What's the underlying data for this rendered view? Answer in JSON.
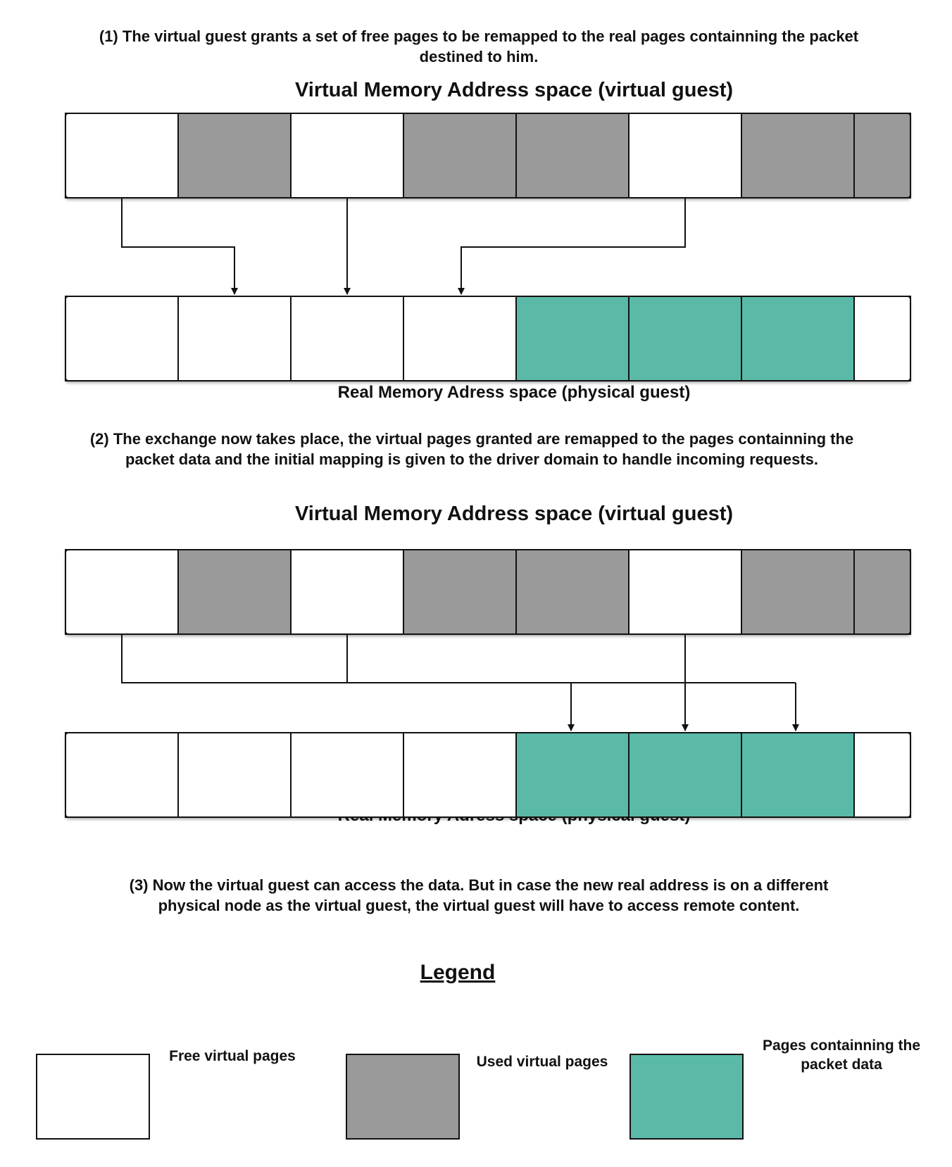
{
  "step1": {
    "line1": "(1)  The virtual guest grants a set of free pages to be remapped to the real pages containning the packet",
    "line2": "destined to him."
  },
  "step2": {
    "line1": "(2)  The exchange now takes place, the virtual pages granted are remapped to the pages containning the",
    "line2": "packet data and the initial mapping is given to the driver domain to handle incoming requests."
  },
  "step3": {
    "line1": "(3) Now the virtual guest can access the data. But in case the new real  address is on a different",
    "line2": "physical node as the virtual guest, the virtual guest will have to access remote content."
  },
  "diagram1": {
    "virtual_title": "Virtual Memory Address space (virtual guest)",
    "real_title": "Real Memory Adress space (physical guest)",
    "virtual_pages": [
      "free",
      "used",
      "free",
      "used",
      "used",
      "free",
      "used",
      "used"
    ],
    "real_pages": [
      "free",
      "free",
      "free",
      "free",
      "packet",
      "packet",
      "packet",
      "free"
    ]
  },
  "diagram2": {
    "virtual_title": "Virtual Memory Address space (virtual guest)",
    "real_title": "Real Memory Adress space (physical guest)",
    "virtual_pages": [
      "free",
      "used",
      "free",
      "used",
      "used",
      "free",
      "used",
      "used"
    ],
    "real_pages": [
      "free",
      "free",
      "free",
      "free",
      "packet",
      "packet",
      "packet",
      "free"
    ]
  },
  "legend": {
    "title": "Legend",
    "free_label": "Free virtual pages",
    "used_label": "Used virtual pages",
    "packet_label_line1": "Pages containning the",
    "packet_label_line2": "packet data"
  },
  "colors": {
    "free": "#ffffff",
    "used": "#9a9a9a",
    "packet": "#5bbaa7",
    "stroke": "#111111"
  }
}
